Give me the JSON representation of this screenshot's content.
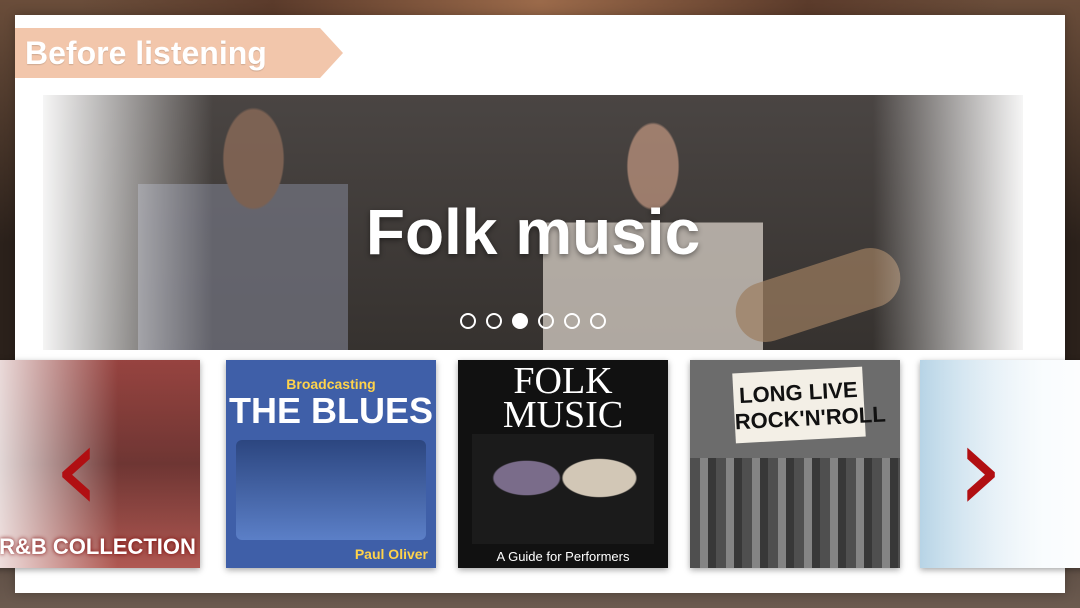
{
  "header": {
    "section_title": "Before listening"
  },
  "hero": {
    "title": "Folk music",
    "dots": {
      "count": 6,
      "active_index": 2
    }
  },
  "thumbnails": [
    {
      "name": "rnb-collection",
      "label": "R&B COLLECTION"
    },
    {
      "name": "broadcasting-the-blues",
      "top": "Broadcasting",
      "main": "THE BLUES",
      "bottom": "Paul Oliver"
    },
    {
      "name": "folk-music-guide",
      "main": "FOLK MUSIC",
      "bottom": "A Guide for Performers"
    },
    {
      "name": "long-live-rock-n-roll",
      "sign": "LONG LIVE ROCK'N'ROLL"
    },
    {
      "name": "partial-album"
    }
  ],
  "arrows": {
    "left": "‹",
    "right": "›"
  },
  "colors": {
    "tag_bg": "#f2c6ab",
    "arrow": "#b10f12"
  }
}
